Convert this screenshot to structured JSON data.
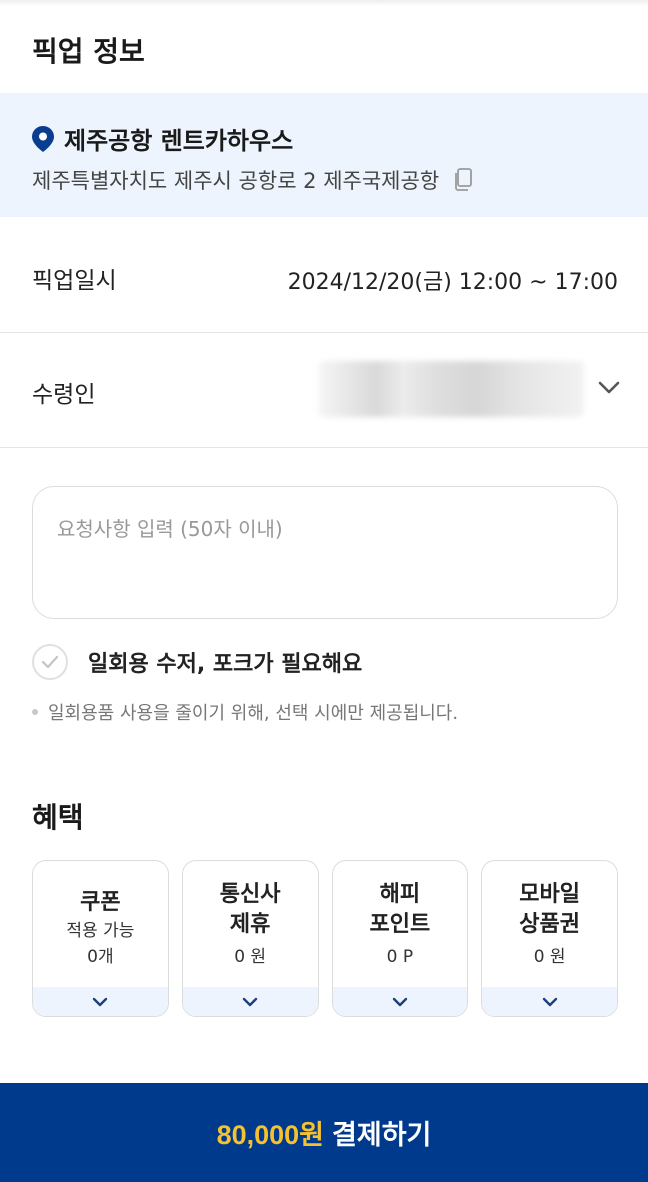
{
  "pickup": {
    "section_title": "픽업 정보",
    "location_name": "제주공항 렌트카하우스",
    "address": "제주특별자치도 제주시 공항로 2 제주국제공항",
    "datetime_label": "픽업일시",
    "datetime_value": "2024/12/20(금) 12:00 ~ 17:00",
    "receiver_label": "수령인",
    "request_placeholder": "요청사항 입력 (50자 이내)",
    "utensils_label": "일회용 수저, 포크가 필요해요",
    "utensils_checked": false,
    "utensils_note": "일회용품 사용을 줄이기 위해, 선택 시에만 제공됩니다."
  },
  "benefits": {
    "section_title": "혜택",
    "coupon": {
      "title": "쿠폰",
      "sub": "적용 가능",
      "count": "0개"
    },
    "telecom": {
      "title_line1": "통신사",
      "title_line2": "제휴",
      "amount": "0 원"
    },
    "happy_point": {
      "title_line1": "해피",
      "title_line2": "포인트",
      "amount": "0 P"
    },
    "mobile_gift": {
      "title_line1": "모바일",
      "title_line2": "상품권",
      "amount": "0 원"
    }
  },
  "payment": {
    "price": "80,000원",
    "label": "결제하기"
  },
  "colors": {
    "primary": "#003a8c",
    "price_accent": "#f5c12e",
    "location_bg": "#eef4fd",
    "pin": "#0a3d8f"
  },
  "icons": {
    "pin": "map-pin-icon",
    "copy": "copy-icon",
    "chevron": "chevron-down-icon",
    "check": "check-icon"
  }
}
